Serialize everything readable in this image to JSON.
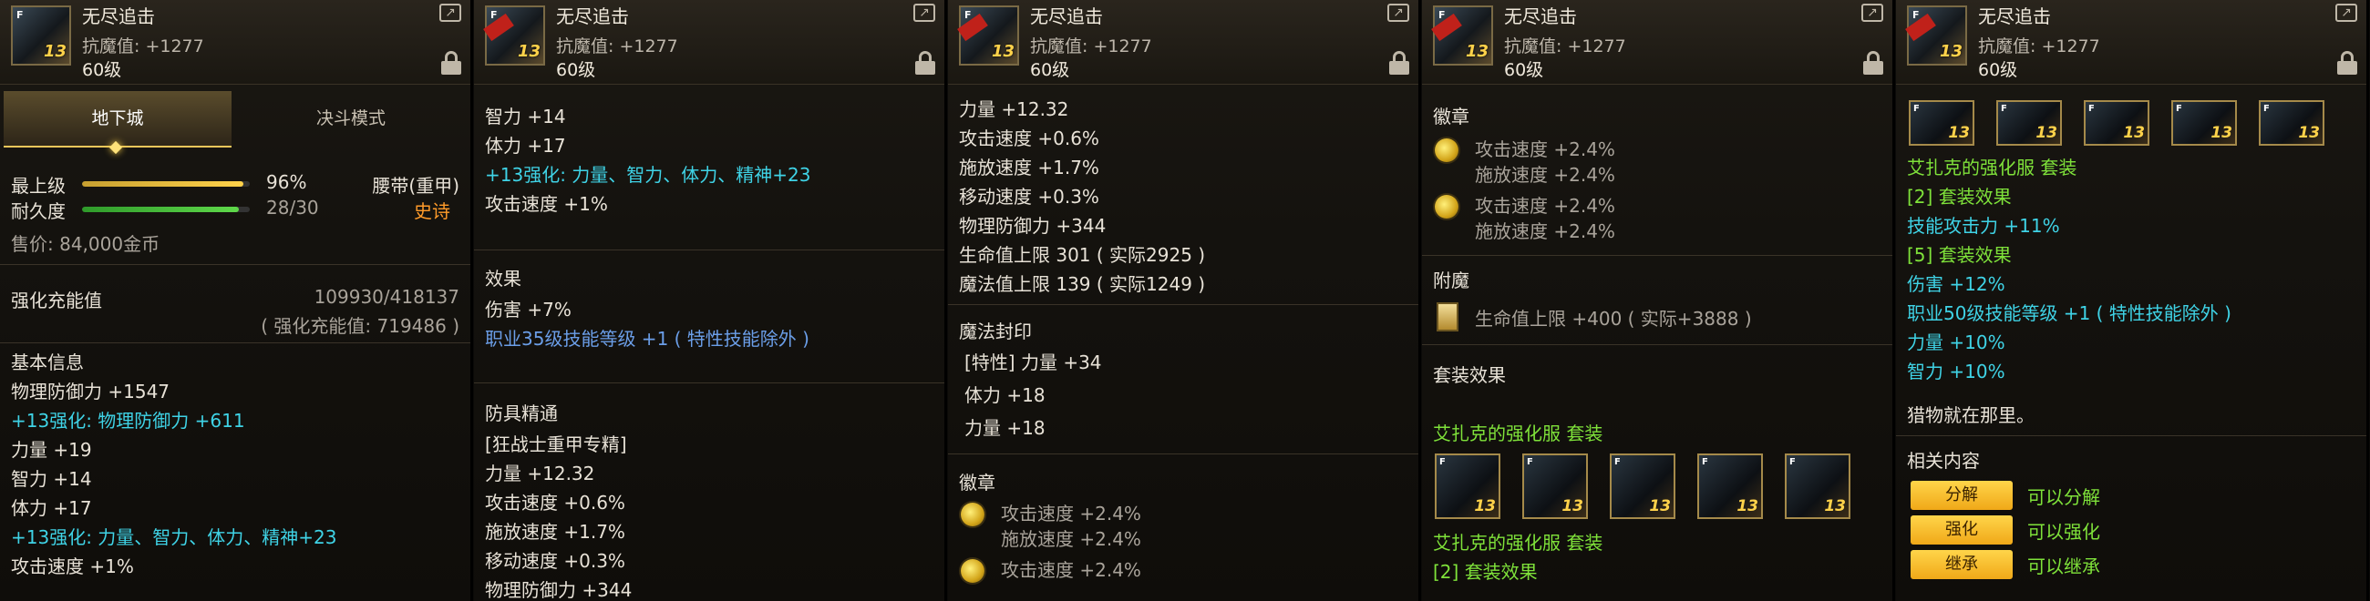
{
  "item": {
    "name": "无尽追击",
    "resist": "抗魔值: +1277",
    "level": "60级",
    "plus": "13",
    "icon_tag": "F"
  },
  "panel1": {
    "tabs": [
      "地下城",
      "决斗模式"
    ],
    "grade_label": "最上级",
    "grade_value": "96%",
    "grade_fraction": 0.96,
    "slot": "腰带(重甲)",
    "rarity": "史诗",
    "durability_label": "耐久度",
    "durability_value": "28/30",
    "durability_fraction": 0.933,
    "price": "售价: 84,000金币",
    "charge_label": "强化充能值",
    "charge_value": "109930/418137",
    "charge_total": "( 强化充能值: 719486 )",
    "base_title": "基本信息",
    "lines": [
      {
        "t": "物理防御力 +1547",
        "c": "w"
      },
      {
        "t": "+13强化: 物理防御力 +611",
        "c": "c"
      },
      {
        "t": "力量 +19",
        "c": "w"
      },
      {
        "t": "智力 +14",
        "c": "w"
      },
      {
        "t": "体力 +17",
        "c": "w"
      },
      {
        "t": "+13强化: 力量、智力、体力、精神+23",
        "c": "c"
      },
      {
        "t": "攻击速度 +1%",
        "c": "w"
      }
    ]
  },
  "panel2": {
    "top": [
      {
        "t": "智力 +14",
        "c": "w"
      },
      {
        "t": "体力 +17",
        "c": "w"
      },
      {
        "t": "+13强化: 力量、智力、体力、精神+23",
        "c": "c"
      },
      {
        "t": "攻击速度 +1%",
        "c": "w"
      }
    ],
    "effect_title": "效果",
    "effects": [
      {
        "t": "伤害 +7%",
        "c": "w"
      },
      {
        "t": "职业35级技能等级 +1 ( 特性技能除外 )",
        "c": "b"
      }
    ],
    "mastery_title": "防具精通",
    "mastery": [
      {
        "t": "[狂战士重甲专精]",
        "c": "w"
      },
      {
        "t": "力量 +12.32",
        "c": "w"
      },
      {
        "t": "攻击速度 +0.6%",
        "c": "w"
      },
      {
        "t": "施放速度 +1.7%",
        "c": "w"
      },
      {
        "t": "移动速度 +0.3%",
        "c": "w"
      },
      {
        "t": "物理防御力 +344",
        "c": "w"
      }
    ]
  },
  "panel3": {
    "top": [
      {
        "t": "力量 +12.32",
        "c": "w"
      },
      {
        "t": "攻击速度 +0.6%",
        "c": "w"
      },
      {
        "t": "施放速度 +1.7%",
        "c": "w"
      },
      {
        "t": "移动速度 +0.3%",
        "c": "w"
      },
      {
        "t": "物理防御力 +344",
        "c": "w"
      },
      {
        "t": "生命值上限 301 ( 实际2925 )",
        "c": "w"
      },
      {
        "t": "魔法值上限 139 ( 实际1249 )",
        "c": "w"
      }
    ],
    "seal_title": "魔法封印",
    "seals": [
      {
        "t": "[特性] 力量 +34",
        "c": "w"
      },
      {
        "t": "体力 +18",
        "c": "w"
      },
      {
        "t": "力量 +18",
        "c": "w"
      }
    ],
    "emblem_title": "徽章",
    "emblems": [
      [
        "攻击速度 +2.4%",
        "施放速度 +2.4%"
      ],
      [
        "攻击速度 +2.4%"
      ]
    ]
  },
  "panel4": {
    "emblem_title": "徽章",
    "emblems": [
      [
        "攻击速度 +2.4%",
        "施放速度 +2.4%"
      ],
      [
        "攻击速度 +2.4%",
        "施放速度 +2.4%"
      ]
    ],
    "enchant_title": "附魔",
    "enchant": "生命值上限 +400 ( 实际+3888 )",
    "set_title": "套装效果",
    "set_name": "艾扎克的强化服  套装",
    "set_name2": "艾扎克的强化服  套装",
    "set_bonus": "[2] 套装效果"
  },
  "panel5": {
    "set_name": "艾扎克的强化服  套装",
    "lines": [
      {
        "t": "[2] 套装效果",
        "c": "g"
      },
      {
        "t": "技能攻击力 +11%",
        "c": "c"
      },
      {
        "t": "[5] 套装效果",
        "c": "g"
      },
      {
        "t": "伤害 +12%",
        "c": "c"
      },
      {
        "t": "职业50级技能等级 +1 ( 特性技能除外 )",
        "c": "c"
      },
      {
        "t": "力量 +10%",
        "c": "c"
      },
      {
        "t": "智力 +10%",
        "c": "c"
      }
    ],
    "flavor": "猎物就在那里。",
    "related_title": "相关内容",
    "actions": [
      {
        "btn": "分解",
        "desc": "可以分解"
      },
      {
        "btn": "强化",
        "desc": "可以强化"
      },
      {
        "btn": "继承",
        "desc": "可以继承"
      }
    ]
  },
  "colors": {
    "cyan": "#3fd3e6",
    "green": "#7fe23a",
    "blue": "#6b9ee8",
    "orange": "#ff9b2a",
    "gold": "#ffd24a"
  }
}
